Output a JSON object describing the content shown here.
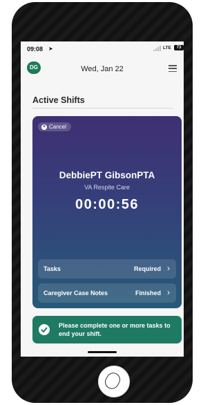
{
  "status_bar": {
    "time": "09:08",
    "location_icon": "location-arrow-icon",
    "network": "LTE",
    "battery": "73"
  },
  "header": {
    "avatar_initials": "DG",
    "date": "Wed, Jan 22",
    "menu_icon": "hamburger-menu-icon"
  },
  "section": {
    "title": "Active Shifts"
  },
  "shift_card": {
    "cancel_label": "Cancel",
    "patient_name": "DebbiePT GibsonPTA",
    "facility": "VA Respite Care",
    "timer": "00:00:56",
    "rows": [
      {
        "label": "Tasks",
        "status": "Required"
      },
      {
        "label": "Caregiver Case Notes",
        "status": "Finished"
      }
    ]
  },
  "alert": {
    "message": "Please complete one or more tasks to end your shift.",
    "icon": "check-circle-icon"
  },
  "colors": {
    "brand_green": "#1f7a57",
    "card_top": "#3f2f73",
    "card_bottom": "#275a78",
    "alert_bg": "#1f7a64"
  }
}
